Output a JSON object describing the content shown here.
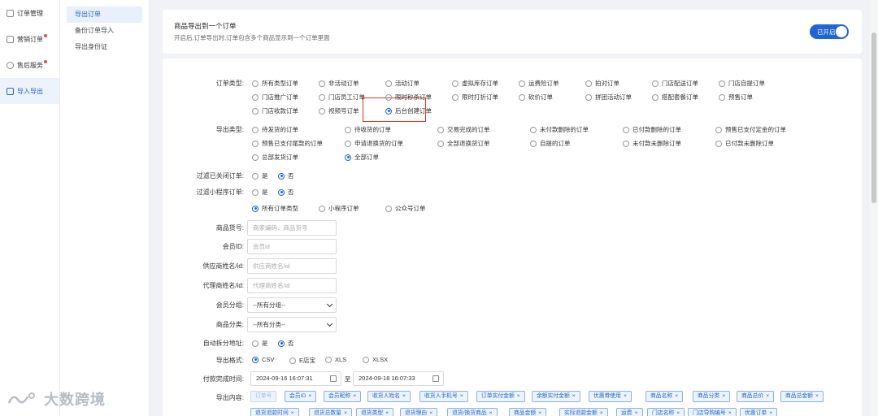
{
  "sidebar": {
    "items": [
      {
        "label": "订单管理",
        "icon": "order-icon",
        "dot": false
      },
      {
        "label": "营销订单",
        "icon": "marketing-icon",
        "dot": true
      },
      {
        "label": "售后服务",
        "icon": "service-icon",
        "dot": true
      },
      {
        "label": "导入导出",
        "icon": "import-export-icon",
        "dot": false,
        "active": true
      }
    ]
  },
  "subnav": {
    "items": [
      "导出订单",
      "备份订单导入",
      "导出身份证"
    ],
    "active": 0
  },
  "merge_card": {
    "title": "商品导出到一个订单",
    "desc": "开启后,订单导出时,订单包含多个商品显示到一个订单里面",
    "toggle_label": "已开启",
    "toggle_on": true
  },
  "form": {
    "order_type": {
      "label": "订单类型:",
      "options": [
        "所有类型订单",
        "非活动订单",
        "活动订单",
        "虚拟库存订单",
        "运费险订单",
        "拍对订单",
        "门店配送订单",
        "门店自提订单",
        "门店推广订单",
        "门店员工订单",
        "限时秒杀订单",
        "限时打折订单",
        "砍价订单",
        "拼团活动订单",
        "搭配套餐订单",
        "预售订单",
        "门店收款订单",
        "视频号订单",
        "后台创建订单"
      ],
      "selected": 18
    },
    "export_type": {
      "label": "导出类型:",
      "options": [
        "待发货的订单",
        "待收货的订单",
        "交易完成的订单",
        "未付款删除的订单",
        "已付款删除的订单",
        "预售已支付定金的订单",
        "预售已支付尾款的订单",
        "申请退换货的订单",
        "全部退换货订单",
        "自提的订单",
        "未付款未删除订单",
        "已付款未删除订单",
        "总部发货订单",
        "全部订单"
      ],
      "selected": 13
    },
    "filter_closed": {
      "label": "过滤已关闭订单:",
      "options": [
        "是",
        "否"
      ],
      "selected": 1
    },
    "filter_mini": {
      "label": "过滤小程序订单:",
      "options": [
        "是",
        "否"
      ],
      "selected": 1
    },
    "mini_scope": {
      "options": [
        "所有订单类型",
        "小程序订单",
        "公众号订单"
      ],
      "selected": 0
    },
    "goods_no": {
      "label": "商品货号:",
      "placeholder": "商家编码、商品货号"
    },
    "member_id": {
      "label": "会员ID:",
      "placeholder": "会员id"
    },
    "supplier": {
      "label": "供应商姓名/id:",
      "placeholder": "供应商姓名/id"
    },
    "agent": {
      "label": "代理商姓名/id:",
      "placeholder": "代理商姓名/id"
    },
    "member_group": {
      "label": "会员分组:",
      "value": "--所有分组--"
    },
    "goods_category": {
      "label": "商品分类:",
      "value": "--所有分类--"
    },
    "auto_split": {
      "label": "自动拆分地址:",
      "options": [
        "是",
        "否"
      ],
      "selected": 1
    },
    "export_format": {
      "label": "导出格式:",
      "options": [
        "CSV",
        "E店宝",
        "XLS",
        "XLSX"
      ],
      "selected": 0
    },
    "pay_time": {
      "label": "付款完成时间:",
      "start": "2024-09-16 16:07:31",
      "sep": "至",
      "end": "2024-09-18 16:07:33"
    },
    "export_content": {
      "label": "导出内容:",
      "tags_row1": [
        "订单号",
        "会员ID",
        "会员昵称",
        "收货人姓名",
        "收货人手机号",
        "订单实付金额",
        "余额实付金额",
        "优惠券使用",
        "商品名称",
        "商品分类",
        "商品总价",
        "商品总金额"
      ],
      "tags_row2": [
        "退货退款时间",
        "退货总数量",
        "退货类型",
        "退货理由",
        "退货/换货商品",
        "商品金额",
        "实际退款金额",
        "运费",
        "门店名称",
        "门店导购编号",
        "优惠订单"
      ]
    }
  },
  "watermark": "大数跨境"
}
